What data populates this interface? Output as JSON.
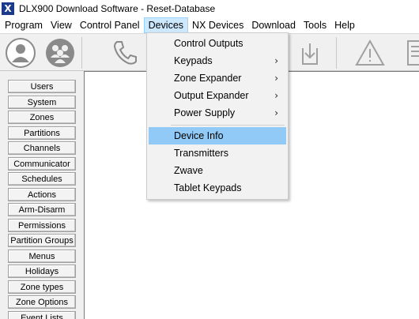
{
  "window": {
    "title": "DLX900 Download Software - Reset-Database",
    "app_icon": "X"
  },
  "menubar": {
    "items": [
      "Program",
      "View",
      "Control Panel",
      "Devices",
      "NX Devices",
      "Download",
      "Tools",
      "Help"
    ],
    "active": "Devices"
  },
  "toolbar": {
    "icons": [
      "user-icon",
      "users-group-icon",
      "phone-icon",
      "download-icon",
      "warning-icon",
      "document-icon"
    ]
  },
  "leftnav": {
    "items": [
      "Users",
      "System",
      "Zones",
      "Partitions",
      "Channels",
      "Communicator",
      "Schedules",
      "Actions",
      "Arm-Disarm",
      "Permissions",
      "Partition Groups",
      "Menus",
      "Holidays",
      "Zone types",
      "Zone Options",
      "Event Lists"
    ]
  },
  "devices_menu": {
    "items": [
      {
        "label": "Control Outputs",
        "submenu": false
      },
      {
        "label": "Keypads",
        "submenu": true
      },
      {
        "label": "Zone Expander",
        "submenu": true
      },
      {
        "label": "Output Expander",
        "submenu": true
      },
      {
        "label": "Power Supply",
        "submenu": true
      },
      {
        "label": "Device Info",
        "submenu": false,
        "highlighted": true
      },
      {
        "label": "Transmitters",
        "submenu": false
      },
      {
        "label": "Zwave",
        "submenu": false
      },
      {
        "label": "Tablet Keypads",
        "submenu": false
      }
    ]
  },
  "colors": {
    "menu_highlight": "#91c9f7",
    "menubar_active": "#cce8ff",
    "app_icon_bg": "#1b3a8c"
  }
}
